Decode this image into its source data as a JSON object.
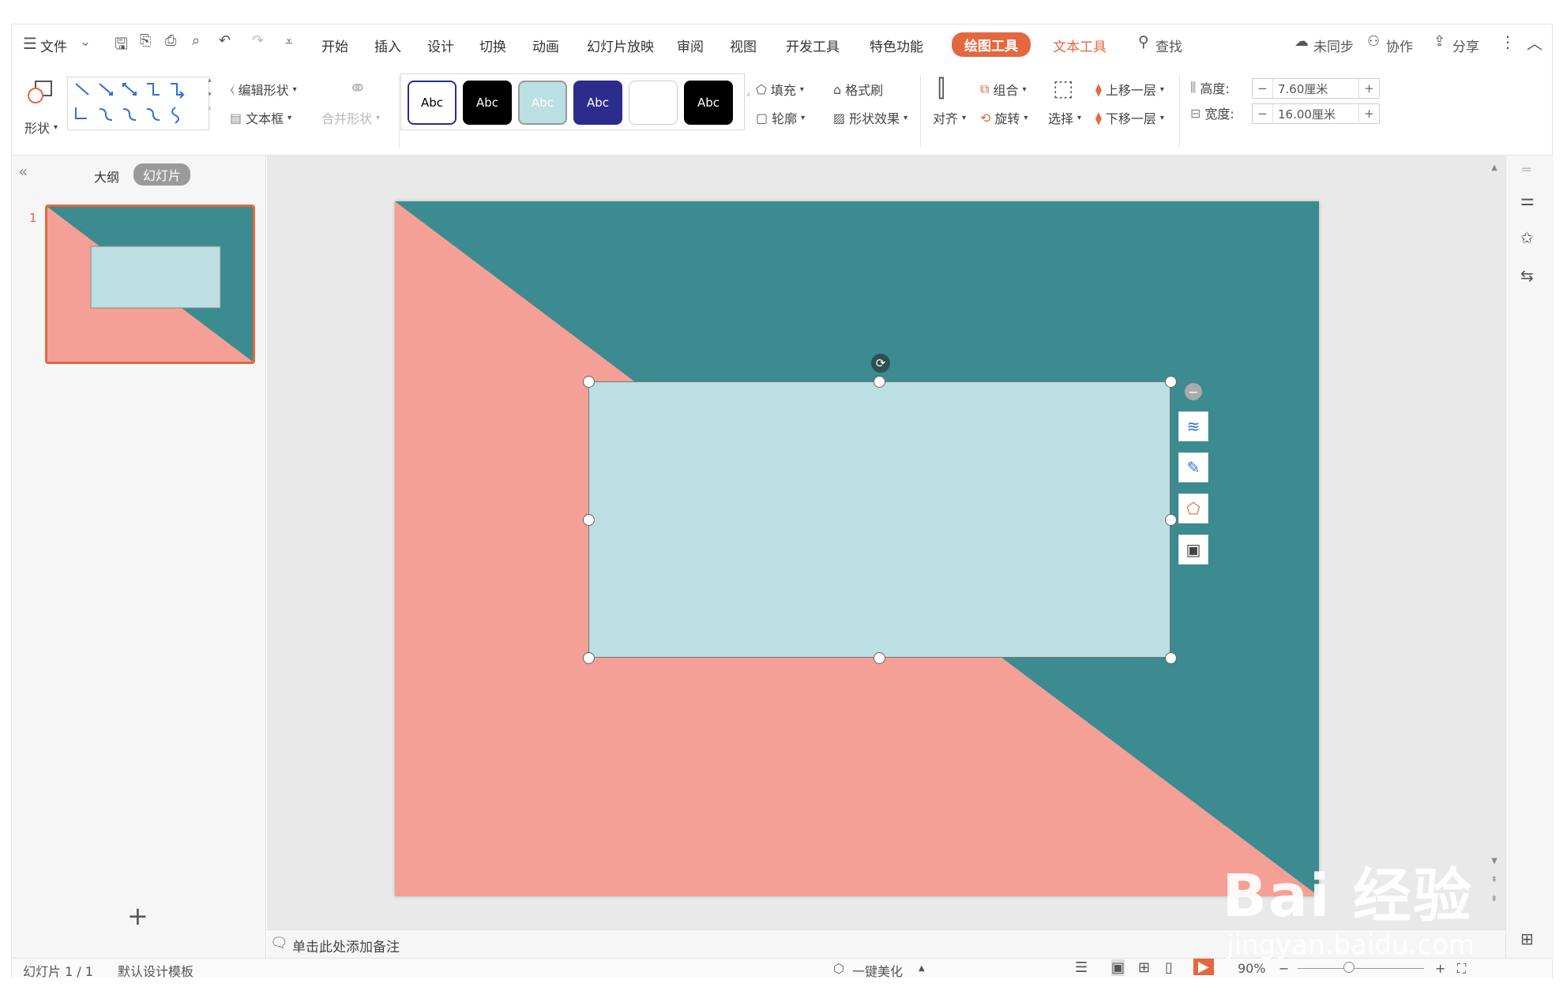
{
  "menubar": {
    "file": "文件",
    "tabs": [
      "开始",
      "插入",
      "设计",
      "切换",
      "动画",
      "幻灯片放映",
      "审阅",
      "视图",
      "开发工具",
      "特色功能"
    ],
    "active_tab": "绘图工具",
    "text_tool": "文本工具",
    "search": "查找",
    "unsynced": "未同步",
    "collab": "协作",
    "share": "分享"
  },
  "ribbon": {
    "shape": "形状",
    "edit_shape": "编辑形状",
    "textbox": "文本框",
    "merge_shape": "合并形状",
    "style_label": "Abc",
    "fill": "填充",
    "format_brush": "格式刷",
    "outline": "轮廓",
    "shape_effect": "形状效果",
    "align": "对齐",
    "group": "组合",
    "rotate": "旋转",
    "select": "选择",
    "bring_forward": "上移一层",
    "send_backward": "下移一层",
    "height_label": "高度:",
    "height_value": "7.60厘米",
    "width_label": "宽度:",
    "width_value": "16.00厘米",
    "minus": "−",
    "plus": "+"
  },
  "left_panel": {
    "collapse": "«",
    "tab_outline": "大纲",
    "tab_slides": "幻灯片",
    "slide_number": "1",
    "add": "+"
  },
  "notes": {
    "placeholder": "单击此处添加备注"
  },
  "status": {
    "slide_info": "幻灯片 1 / 1",
    "template": "默认设计模板",
    "beautify": "一键美化",
    "zoom": "90%"
  },
  "watermark": {
    "main": "Bai 经验",
    "sub": "jingyan.baidu.com"
  },
  "colors": {
    "accent": "#e5673f",
    "slide_teal": "#3b8b91",
    "slide_salmon": "#f4a097",
    "rect_fill": "#bbdfe2",
    "style_navy": "#2b2c8c"
  }
}
